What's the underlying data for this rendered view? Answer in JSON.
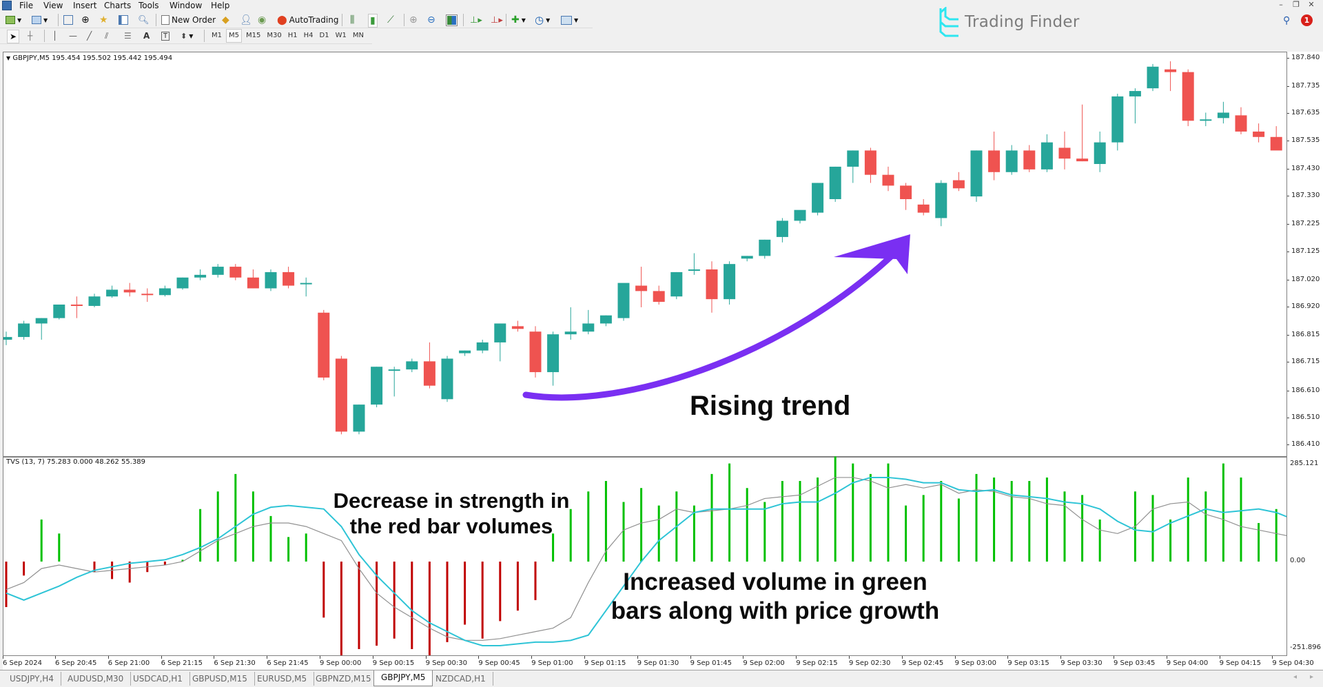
{
  "menu": [
    "File",
    "View",
    "Insert",
    "Charts",
    "Tools",
    "Window",
    "Help"
  ],
  "window_controls": [
    "minimize",
    "restore",
    "close"
  ],
  "toolbar": {
    "new_order_label": "New Order",
    "autotrading_label": "AutoTrading",
    "timeframes": [
      "M1",
      "M5",
      "M15",
      "M30",
      "H1",
      "H4",
      "D1",
      "W1",
      "MN"
    ],
    "active_timeframe": "M5"
  },
  "brand": {
    "name": "Trading Finder",
    "color": "#2ee6f0"
  },
  "notifications": {
    "count": "1"
  },
  "chart": {
    "symbol_header": "GBPJPY,M5  195.454 195.502 195.442 195.494",
    "indicator_header": "TVS (13, 7) 75.283 0.000 48.262 55.389",
    "colors": {
      "bull": "#26a69a",
      "bear": "#ef5350",
      "vol_up": "#00c000",
      "vol_down": "#c00000",
      "signal_cyan": "#2ec4d6",
      "signal_gray": "#909090",
      "arrow": "#7a2ff2"
    },
    "price_axis_labels": [
      "187.840",
      "187.735",
      "187.635",
      "187.535",
      "187.430",
      "187.330",
      "187.225",
      "187.125",
      "187.020",
      "186.920",
      "186.815",
      "186.715",
      "186.610",
      "186.510",
      "186.410"
    ],
    "indicator_axis_labels": [
      "285.121",
      "0.00",
      "-251.896"
    ],
    "time_axis_labels": [
      "6 Sep 2024",
      "6 Sep 20:45",
      "6 Sep 21:00",
      "6 Sep 21:15",
      "6 Sep 21:30",
      "6 Sep 21:45",
      "9 Sep 00:00",
      "9 Sep 00:15",
      "9 Sep 00:30",
      "9 Sep 00:45",
      "9 Sep 01:00",
      "9 Sep 01:15",
      "9 Sep 01:30",
      "9 Sep 01:45",
      "9 Sep 02:00",
      "9 Sep 02:15",
      "9 Sep 02:30",
      "9 Sep 02:45",
      "9 Sep 03:00",
      "9 Sep 03:15",
      "9 Sep 03:30",
      "9 Sep 03:45",
      "9 Sep 04:00",
      "9 Sep 04:15",
      "9 Sep 04:30"
    ],
    "annotations": {
      "rising_trend": "Rising trend",
      "red_bars": [
        "Decrease in strength in",
        "the red bar volumes"
      ],
      "green_bars": [
        "Increased volume in green",
        "bars along with price growth"
      ]
    }
  },
  "chart_data": {
    "type": "candlestick",
    "symbol": "GBPJPY",
    "timeframe": "M5",
    "ylim": [
      186.39,
      187.87
    ],
    "indicator_ylim": [
      -251.896,
      285.121
    ],
    "candles": [
      [
        186.8,
        186.83,
        186.78,
        186.81
      ],
      [
        186.81,
        186.87,
        186.8,
        186.86
      ],
      [
        186.86,
        186.88,
        186.8,
        186.88
      ],
      [
        186.88,
        186.93,
        186.875,
        186.93
      ],
      [
        186.93,
        186.96,
        186.88,
        186.925
      ],
      [
        186.925,
        186.97,
        186.92,
        186.96
      ],
      [
        186.96,
        187.0,
        186.955,
        186.985
      ],
      [
        186.985,
        187.01,
        186.96,
        186.975
      ],
      [
        186.97,
        186.99,
        186.94,
        186.965
      ],
      [
        186.965,
        187.0,
        186.96,
        186.99
      ],
      [
        186.99,
        187.03,
        186.985,
        187.03
      ],
      [
        187.03,
        187.06,
        187.02,
        187.04
      ],
      [
        187.04,
        187.08,
        187.03,
        187.07
      ],
      [
        187.07,
        187.08,
        187.02,
        187.03
      ],
      [
        187.03,
        187.06,
        186.99,
        186.99
      ],
      [
        186.99,
        187.06,
        186.98,
        187.05
      ],
      [
        187.05,
        187.07,
        186.99,
        187.0
      ],
      [
        187.005,
        187.03,
        186.96,
        187.01
      ],
      [
        186.9,
        186.91,
        186.65,
        186.66
      ],
      [
        186.73,
        186.74,
        186.45,
        186.46
      ],
      [
        186.46,
        186.56,
        186.45,
        186.56
      ],
      [
        186.56,
        186.7,
        186.55,
        186.7
      ],
      [
        186.69,
        186.7,
        186.59,
        186.69
      ],
      [
        186.69,
        186.73,
        186.68,
        186.72
      ],
      [
        186.72,
        186.79,
        186.62,
        186.63
      ],
      [
        186.58,
        186.74,
        186.57,
        186.73
      ],
      [
        186.75,
        186.76,
        186.74,
        186.76
      ],
      [
        186.76,
        186.8,
        186.75,
        186.79
      ],
      [
        186.79,
        186.86,
        186.72,
        186.86
      ],
      [
        186.85,
        186.87,
        186.83,
        186.84
      ],
      [
        186.83,
        186.85,
        186.66,
        186.68
      ],
      [
        186.68,
        186.83,
        186.63,
        186.82
      ],
      [
        186.82,
        186.92,
        186.8,
        186.83
      ],
      [
        186.83,
        186.91,
        186.82,
        186.86
      ],
      [
        186.86,
        186.89,
        186.85,
        186.89
      ],
      [
        186.88,
        186.99,
        186.87,
        187.01
      ],
      [
        187.0,
        187.07,
        186.92,
        186.98
      ],
      [
        186.98,
        187.0,
        186.93,
        186.94
      ],
      [
        186.96,
        187.05,
        186.95,
        187.05
      ],
      [
        187.06,
        187.12,
        187.04,
        187.06
      ],
      [
        187.06,
        187.09,
        186.9,
        186.95
      ],
      [
        186.95,
        187.09,
        186.93,
        187.08
      ],
      [
        187.1,
        187.11,
        187.09,
        187.11
      ],
      [
        187.11,
        187.17,
        187.1,
        187.17
      ],
      [
        187.18,
        187.25,
        187.16,
        187.24
      ],
      [
        187.24,
        187.27,
        187.23,
        187.28
      ],
      [
        187.27,
        187.38,
        187.26,
        187.38
      ],
      [
        187.32,
        187.44,
        187.31,
        187.44
      ],
      [
        187.44,
        187.5,
        187.38,
        187.5
      ],
      [
        187.5,
        187.51,
        187.38,
        187.41
      ],
      [
        187.41,
        187.44,
        187.35,
        187.37
      ],
      [
        187.37,
        187.38,
        187.28,
        187.32
      ],
      [
        187.3,
        187.32,
        187.26,
        187.27
      ],
      [
        187.25,
        187.39,
        187.22,
        187.38
      ],
      [
        187.39,
        187.42,
        187.35,
        187.36
      ],
      [
        187.33,
        187.5,
        187.31,
        187.5
      ],
      [
        187.5,
        187.57,
        187.39,
        187.42
      ],
      [
        187.42,
        187.52,
        187.41,
        187.5
      ],
      [
        187.5,
        187.52,
        187.42,
        187.43
      ],
      [
        187.43,
        187.56,
        187.42,
        187.53
      ],
      [
        187.51,
        187.57,
        187.43,
        187.47
      ],
      [
        187.47,
        187.67,
        187.46,
        187.46
      ],
      [
        187.45,
        187.57,
        187.42,
        187.53
      ],
      [
        187.53,
        187.71,
        187.5,
        187.7
      ],
      [
        187.7,
        187.73,
        187.6,
        187.72
      ],
      [
        187.73,
        187.82,
        187.72,
        187.81
      ],
      [
        187.8,
        187.83,
        187.72,
        187.79
      ],
      [
        187.79,
        187.8,
        187.59,
        187.61
      ],
      [
        187.615,
        187.64,
        187.59,
        187.615
      ],
      [
        187.62,
        187.68,
        187.6,
        187.64
      ],
      [
        187.63,
        187.66,
        187.56,
        187.57
      ],
      [
        187.57,
        187.6,
        187.53,
        187.55
      ],
      [
        187.55,
        187.59,
        187.51,
        187.5
      ],
      [
        187.5,
        187.54,
        187.49,
        187.505
      ]
    ],
    "volume_bars": [
      -130,
      -40,
      120,
      80,
      0,
      -30,
      -50,
      -60,
      -30,
      -10,
      5,
      150,
      200,
      250,
      200,
      130,
      70,
      80,
      -160,
      -300,
      -250,
      -240,
      -220,
      -250,
      -290,
      -230,
      -180,
      -220,
      -170,
      -140,
      -110,
      80,
      150,
      200,
      230,
      170,
      210,
      160,
      200,
      160,
      250,
      280,
      210,
      170,
      230,
      230,
      240,
      300,
      280,
      250,
      280,
      160,
      190,
      230,
      180,
      250,
      240,
      230,
      230,
      240,
      200,
      190,
      120,
      0,
      200,
      190,
      120,
      240,
      200,
      280,
      240,
      110,
      150,
      120,
      80,
      40,
      100,
      130,
      50
    ],
    "signal_cyan": [
      -90,
      -110,
      -90,
      -70,
      -45,
      -25,
      -15,
      -5,
      0,
      5,
      20,
      40,
      65,
      100,
      135,
      155,
      160,
      155,
      150,
      100,
      20,
      -40,
      -90,
      -140,
      -175,
      -200,
      -225,
      -240,
      -240,
      -235,
      -230,
      -230,
      -225,
      -210,
      -140,
      -70,
      0,
      60,
      100,
      140,
      150,
      150,
      150,
      150,
      165,
      170,
      170,
      195,
      225,
      240,
      240,
      235,
      225,
      225,
      205,
      200,
      205,
      190,
      185,
      180,
      170,
      165,
      150,
      115,
      90,
      85,
      110,
      130,
      150,
      140,
      145,
      150,
      140,
      120,
      90
    ],
    "signal_gray": [
      -80,
      -60,
      -20,
      -10,
      -20,
      -30,
      -25,
      -20,
      -15,
      -10,
      0,
      30,
      60,
      80,
      100,
      110,
      110,
      100,
      80,
      60,
      -20,
      -90,
      -130,
      -160,
      -190,
      -215,
      -225,
      -225,
      -220,
      -210,
      -200,
      -190,
      -160,
      -60,
      30,
      90,
      110,
      120,
      150,
      140,
      145,
      150,
      160,
      180,
      185,
      190,
      215,
      240,
      240,
      230,
      210,
      220,
      210,
      220,
      195,
      205,
      200,
      185,
      180,
      165,
      160,
      120,
      90,
      80,
      100,
      150,
      165,
      170,
      135,
      120,
      100,
      90,
      80,
      70,
      60
    ]
  }
}
